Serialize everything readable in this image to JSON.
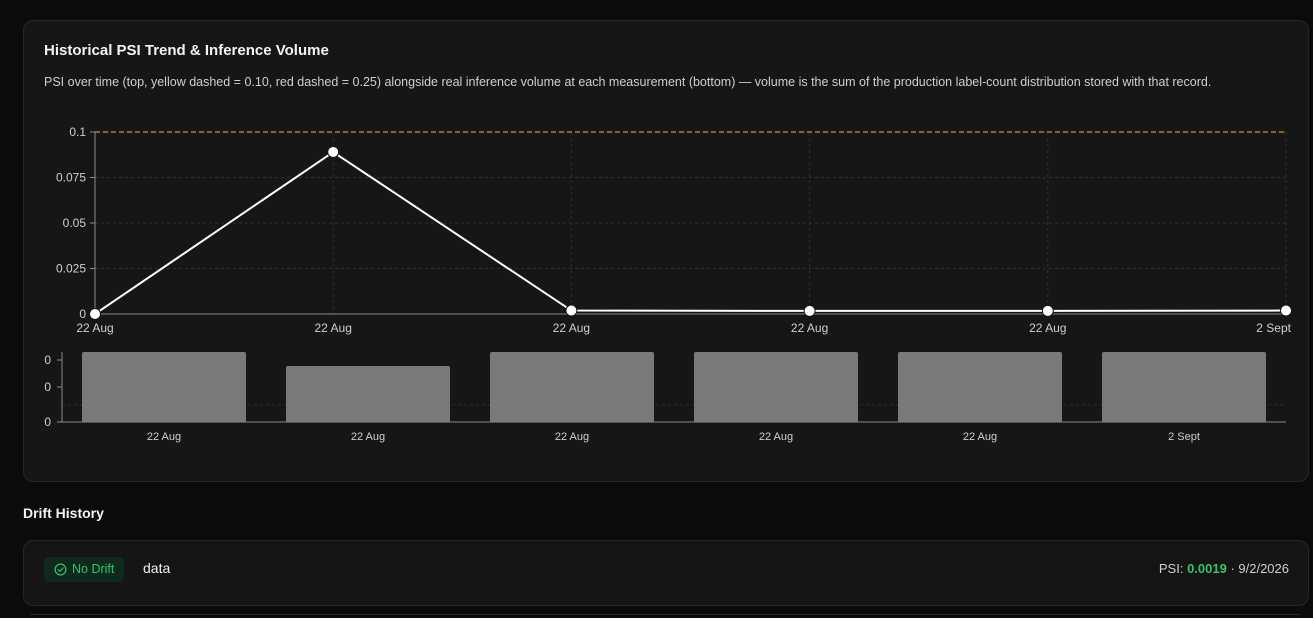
{
  "card": {
    "title": "Historical PSI Trend & Inference Volume",
    "description": "PSI over time (top, yellow dashed = 0.10, red dashed = 0.25) alongside real inference volume at each measurement (bottom) — volume is the sum of the production label-count distribution stored with that record."
  },
  "colors": {
    "threshold_line": "#d9882b",
    "psi_line": "#ffffff",
    "volume_bar": "#7a7a7a",
    "no_drift_green": "#32c46b",
    "badge_bg": "#0f2a1c"
  },
  "chart_data": [
    {
      "type": "line",
      "x": [
        "22 Aug",
        "22 Aug",
        "22 Aug",
        "22 Aug",
        "22 Aug",
        "2 Sept"
      ],
      "series": [
        {
          "values": [
            0,
            0.089,
            0.0019,
            0.0017,
            0.0017,
            0.0019
          ]
        }
      ],
      "y_ticks": [
        "0",
        "0.025",
        "0.05",
        "0.075",
        "0.1"
      ],
      "ylim": [
        0,
        0.1
      ],
      "thresholds": [
        {
          "value": 0.1,
          "color": "yellow",
          "style": "dashed"
        }
      ],
      "grid": true
    },
    {
      "type": "bar",
      "categories": [
        "22 Aug",
        "22 Aug",
        "22 Aug",
        "22 Aug",
        "22 Aug",
        "2 Sept"
      ],
      "values": [
        1,
        0.8,
        1,
        1,
        1,
        1
      ],
      "y_ticks": [
        "0",
        "0",
        "0"
      ],
      "grid": true
    }
  ],
  "history": {
    "title": "Drift History",
    "rows": [
      {
        "status": "No Drift",
        "status_icon": "check-circle-icon",
        "label": "data",
        "psi_prefix": "PSI: ",
        "psi": "0.0019",
        "date": " · 9/2/2026"
      }
    ]
  }
}
